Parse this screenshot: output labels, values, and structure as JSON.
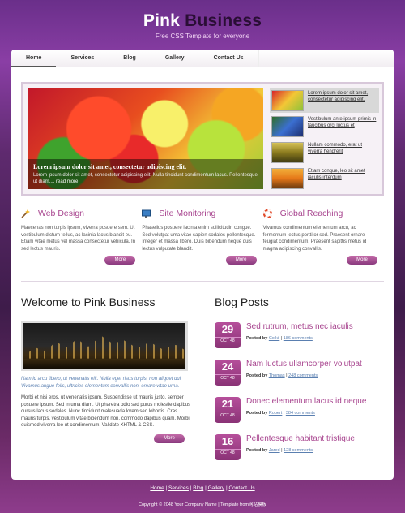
{
  "header": {
    "logo_pink": "Pink",
    "logo_business": "Business",
    "tagline": "Free CSS Template for everyone"
  },
  "nav": [
    "Home",
    "Services",
    "Blog",
    "Gallery",
    "Contact Us"
  ],
  "hero": {
    "caption_title": "Lorem ipsum dolor sit amet, consectetur adipiscing elit.",
    "caption_text": "Lorem ipsum dolor sit amet, consectetur adipiscing elit. Nulla tincidunt condimentum lacus. Pellentesque ut diam....",
    "caption_more": "read more"
  },
  "thumbs": [
    "Lorem ipsum dolor sit amet, consectetur adipiscing elit.",
    "Vestibulum ante ipsum primis in faucibus orci luctus et",
    "Nullam commodo, erat ut viverra hendrerit",
    "Etiam congue, leo sit amet iaculis interdum"
  ],
  "features": [
    {
      "title": "Web Design",
      "text": "Maecenas non turpis ipsum, viverra posuere sem. Ut vestibulum dictum tellus, ac lacinia lacus blandit eu. Etiam vitae metus vel massa consectetur vehicula. In sed lectus mauris.",
      "more": "More"
    },
    {
      "title": "Site Monitoring",
      "text": "Phasellus posuere lacinia enim sollicitudin congue. Sed volutpat uma vitae sapien sodales pellentesque. Integer et massa libero. Duis bibendum neque quis lectus vulputate blandit.",
      "more": "More"
    },
    {
      "title": "Global Reaching",
      "text": "Vivamus condimentum elementum arcu, ac fermentum lectus porttitor sed. Praesent ornare feugiat condimentum. Praesent sagittis metus id magna adipiscing convallis.",
      "more": "More"
    }
  ],
  "welcome": {
    "title": "Welcome to Pink Business",
    "intro": "Nam id arcu libero, ut venenatis elit. Nulla eget risus turpis, non aliquet dui. Vivamus augue felis, ultricies elementum convallis non, ornare vitae urna.",
    "body": "Morbi et nisi eros, ut venenatis ipsum. Suspendisse ut mauris justo, semper posuere ipsum. Sed in urna diam. Ut pharetra odio sed purus molestie dapibus cursus lacus sodales. Nunc tincidunt malesuada lorem sed lobortis. Cras mauris turpis, vestibulum vitae bibendum non, commodo dapibus quam. Morbi euismod viverra leo ut condimentum. Validate XHTML & CSS.",
    "more": "More"
  },
  "blog": {
    "title": "Blog Posts",
    "posted_by": "Posted by",
    "posts": [
      {
        "day": "29",
        "month": "OCT 48",
        "title": "Sed rutrum, metus nec iaculis",
        "author": "Coikil",
        "comments": "186 comments"
      },
      {
        "day": "24",
        "month": "OCT 48",
        "title": "Nam luctus ullamcorper volutpat",
        "author": "Thomas",
        "comments": "248 comments"
      },
      {
        "day": "21",
        "month": "OCT 48",
        "title": "Donec elementum lacus id neque",
        "author": "Robert",
        "comments": "384 comments"
      },
      {
        "day": "16",
        "month": "OCT 48",
        "title": "Pellentesque habitant tristique",
        "author": "Jared",
        "comments": "128 comments"
      }
    ]
  },
  "footer": {
    "links": [
      "Home",
      "Services",
      "Blog",
      "Gallery",
      "Contact Us"
    ],
    "copyright_prefix": "Copyright © 2048",
    "company": "Your Company Name",
    "template_from": "Template from",
    "template_site": "网站模板"
  },
  "colors": {
    "accent": "#a8458f",
    "link": "#5a7fb0",
    "background": "#5e2a6e"
  },
  "icons": {
    "web_design": "wand-icon",
    "site_monitoring": "monitor-icon",
    "global_reaching": "lifebuoy-icon"
  }
}
